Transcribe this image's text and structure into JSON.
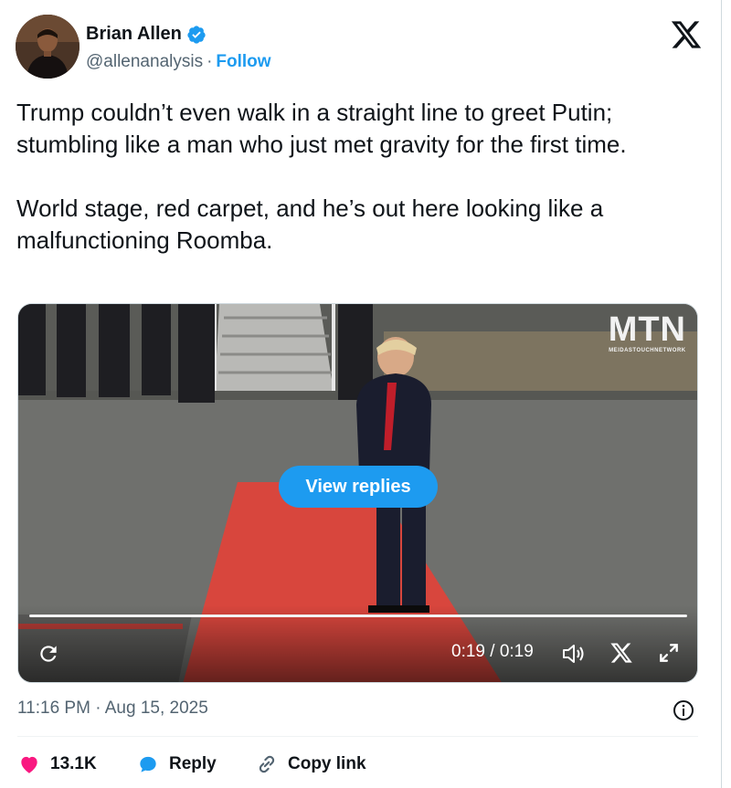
{
  "author": {
    "name": "Brian Allen",
    "handle": "@allenanalysis",
    "separator": "·",
    "follow_label": "Follow"
  },
  "tweet": {
    "text": "Trump couldn’t even walk in a straight line to greet Putin; stumbling like a man who just met gravity for the first time.\n\nWorld stage, red carpet, and he’s out here looking like a malfunctioning Roomba."
  },
  "media": {
    "watermark": "MTN",
    "watermark_sub": "MEIDASTOUCHNETWORK",
    "view_replies_label": "View replies",
    "time_display": "0:19 / 0:19",
    "progress": 1.0
  },
  "meta": {
    "timestamp": "11:16 PM · Aug 15, 2025"
  },
  "actions": {
    "like_count": "13.1K",
    "reply_label": "Reply",
    "copy_link_label": "Copy link"
  },
  "colors": {
    "accent": "#1d9bf0",
    "like": "#f91880",
    "text": "#0f1419",
    "muted": "#536471"
  },
  "icons": [
    "verified-badge-icon",
    "x-logo-icon",
    "replay-icon",
    "volume-icon",
    "x-small-icon",
    "expand-icon",
    "info-icon",
    "heart-icon",
    "reply-bubble-icon",
    "link-icon"
  ]
}
